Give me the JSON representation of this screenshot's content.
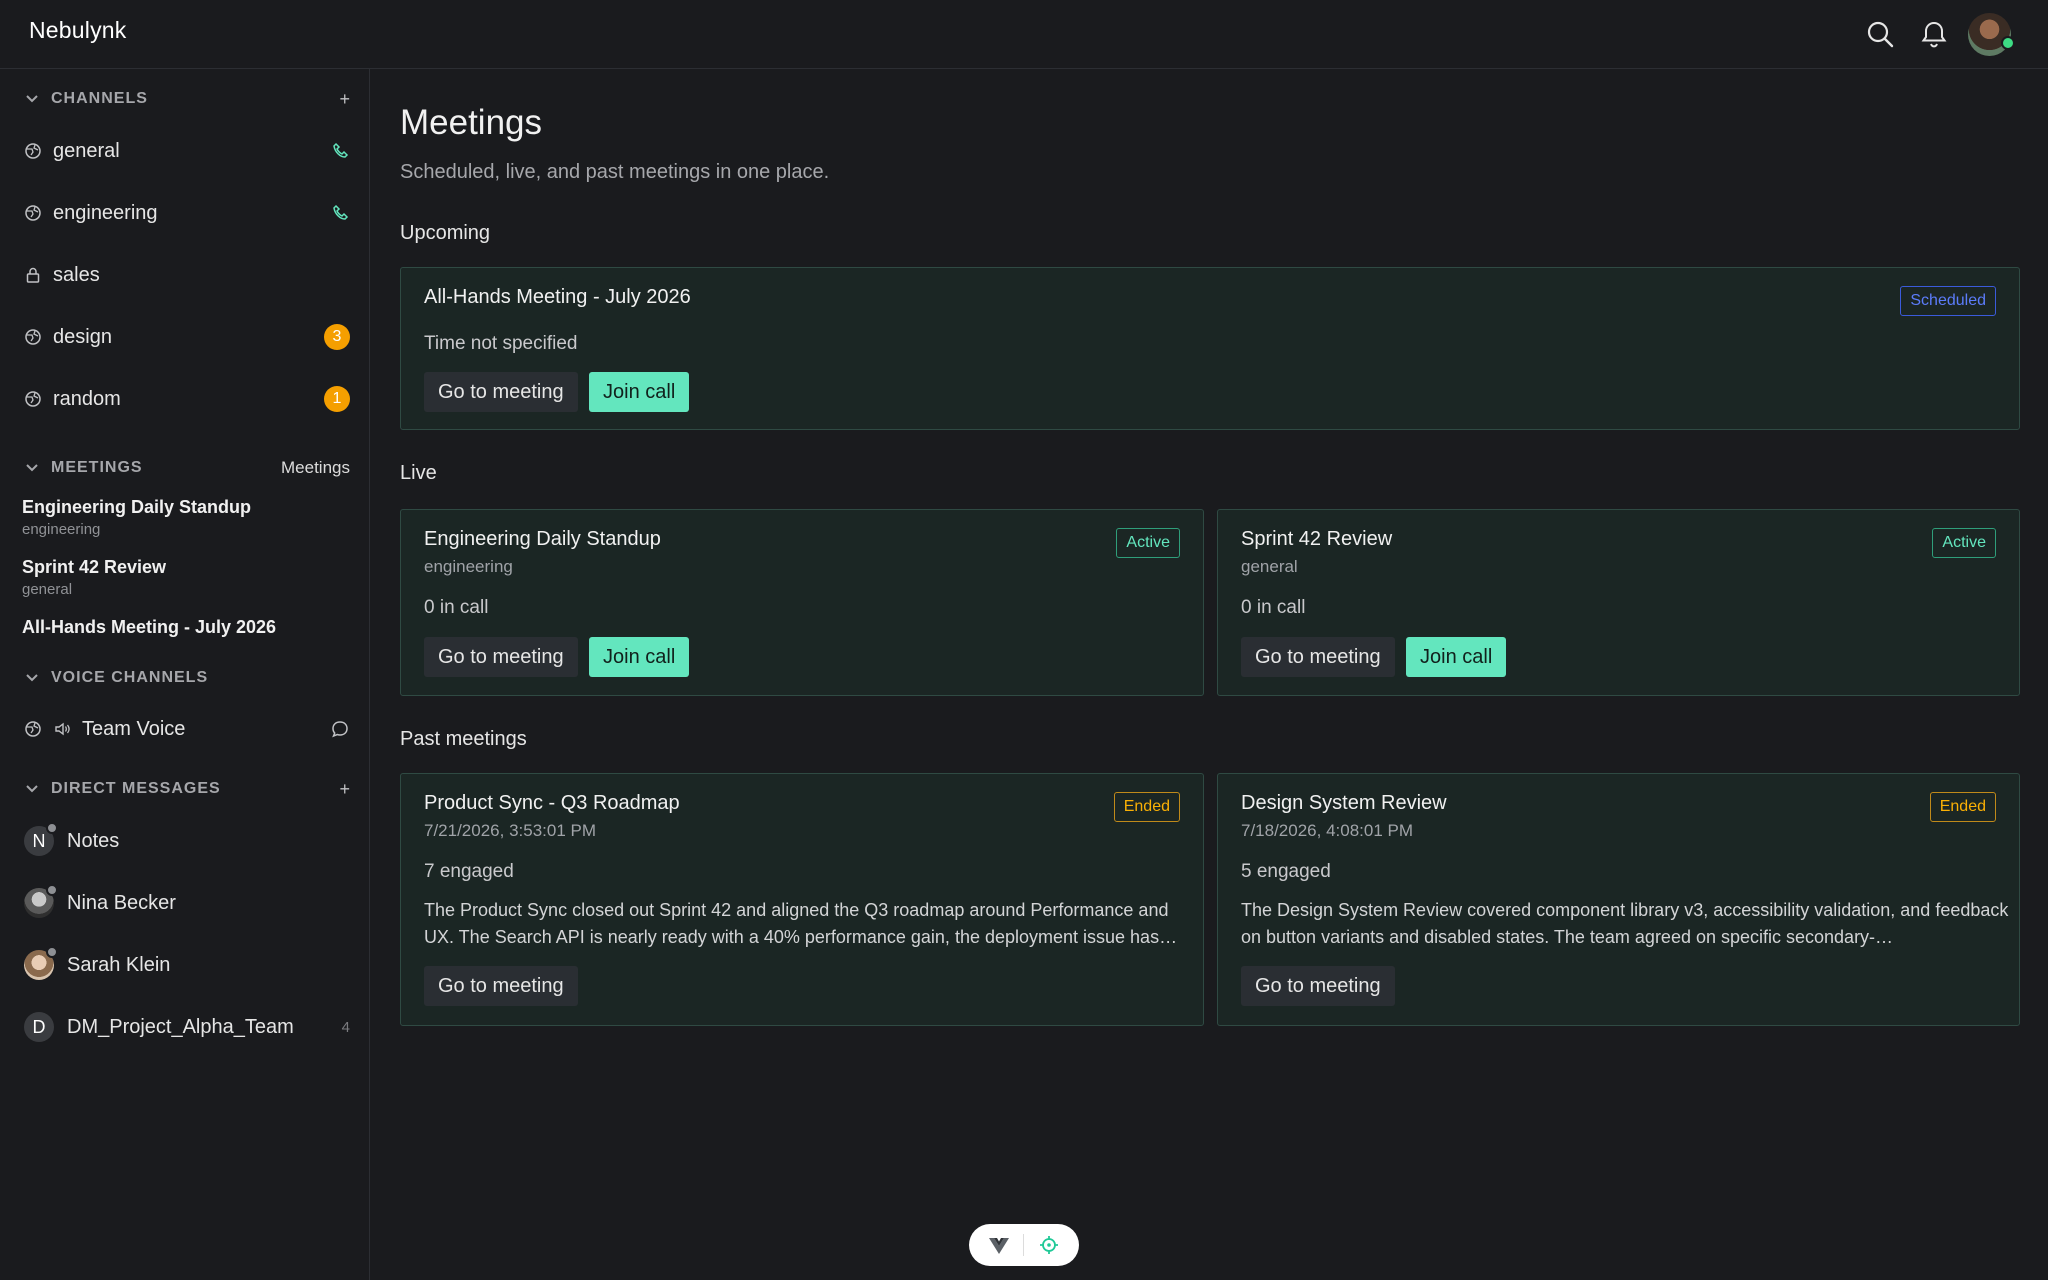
{
  "app": {
    "title": "Nebulynk"
  },
  "header": {
    "search_icon": "search-icon",
    "bell_icon": "bell-icon",
    "avatar": "user-avatar"
  },
  "sidebar": {
    "channels": {
      "header": "CHANNELS",
      "add": "+",
      "items": [
        {
          "name": "general",
          "icon": "globe-icon",
          "trail": "phone-icon"
        },
        {
          "name": "engineering",
          "icon": "globe-icon",
          "trail": "phone-icon"
        },
        {
          "name": "sales",
          "icon": "lock-icon",
          "trail": ""
        },
        {
          "name": "design",
          "icon": "globe-icon",
          "badge": "3"
        },
        {
          "name": "random",
          "icon": "globe-icon",
          "badge": "1"
        }
      ]
    },
    "meetings": {
      "header": "MEETINGS",
      "link": "Meetings",
      "items": [
        {
          "title": "Engineering Daily Standup",
          "channel": "engineering"
        },
        {
          "title": "Sprint 42 Review",
          "channel": "general"
        },
        {
          "title": "All-Hands Meeting - July 2026",
          "channel": ""
        }
      ]
    },
    "voice": {
      "header": "VOICE CHANNELS",
      "items": [
        {
          "name": "Team Voice"
        }
      ]
    },
    "dms": {
      "header": "DIRECT MESSAGES",
      "add": "+",
      "items": [
        {
          "name": "Notes",
          "initial": "N"
        },
        {
          "name": "Nina Becker",
          "initial": ""
        },
        {
          "name": "Sarah Klein",
          "initial": ""
        },
        {
          "name": "DM_Project_Alpha_Team",
          "initial": "D",
          "count": "4"
        }
      ]
    }
  },
  "main": {
    "title": "Meetings",
    "subtitle": "Scheduled, live, and past meetings in one place.",
    "upcoming": {
      "label": "Upcoming",
      "cards": [
        {
          "title": "All-Hands Meeting - July 2026",
          "status": "Scheduled",
          "info": "Time not specified",
          "go": "Go to meeting",
          "join": "Join call"
        }
      ]
    },
    "live": {
      "label": "Live",
      "cards": [
        {
          "title": "Engineering Daily Standup",
          "channel": "engineering",
          "status": "Active",
          "info": "0 in call",
          "go": "Go to meeting",
          "join": "Join call"
        },
        {
          "title": "Sprint 42 Review",
          "channel": "general",
          "status": "Active",
          "info": "0 in call",
          "go": "Go to meeting",
          "join": "Join call"
        }
      ]
    },
    "past": {
      "label": "Past meetings",
      "cards": [
        {
          "title": "Product Sync - Q3 Roadmap",
          "date": "7/21/2026, 3:53:01 PM",
          "status": "Ended",
          "info": "7 engaged",
          "desc": "The Product Sync closed out Sprint 42 and aligned the Q3 roadmap around Performance and UX. The Search API is nearly ready with a 40% performance gain, the deployment issue has…",
          "go": "Go to meeting"
        },
        {
          "title": "Design System Review",
          "date": "7/18/2026, 4:08:01 PM",
          "status": "Ended",
          "info": "5 engaged",
          "desc": "The Design System Review covered component library v3, accessibility validation, and feedback on button variants and disabled states. The team agreed on specific secondary-…",
          "go": "Go to meeting"
        }
      ]
    }
  },
  "colors": {
    "accent": "#63e6be",
    "badge": "#f59f00",
    "scheduled": "#5c7cfa",
    "ended": "#fab005",
    "card_bg": "#1b2624"
  }
}
